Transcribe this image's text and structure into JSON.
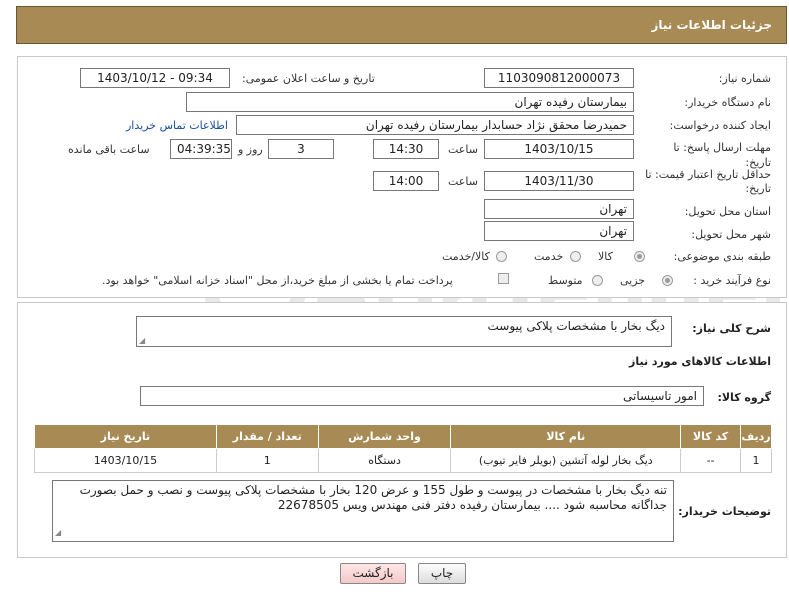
{
  "header": {
    "title": "جزئیات اطلاعات نیاز"
  },
  "form": {
    "need_number_label": "شماره نیاز:",
    "need_number": "1103090812000073",
    "announce_label": "تاریخ و ساعت اعلان عمومی:",
    "announce_value": "1403/10/12 - 09:34",
    "buyer_org_label": "نام دستگاه خریدار:",
    "buyer_org": "بیمارستان رفیده تهران",
    "creator_label": "ایجاد کننده درخواست:",
    "creator": "حمیدرضا  محقق نژاد حسابدار بیمارستان رفیده تهران",
    "contact_link": "اطلاعات تماس خریدار",
    "reply_deadline_label_1": "مهلت ارسال پاسخ: تا",
    "reply_deadline_label_2": "تاریخ:",
    "reply_date": "1403/10/15",
    "time_label": "ساعت",
    "reply_time": "14:30",
    "days_value": "3",
    "days_label": "روز و",
    "remaining_value": "04:39:35",
    "remaining_label": "ساعت باقی مانده",
    "price_validity_label_1": "حداقل تاریخ اعتبار قیمت: تا",
    "price_validity_label_2": "تاریخ:",
    "price_date": "1403/11/30",
    "price_time": "14:00",
    "province_label": "استان محل تحویل:",
    "province": "تهران",
    "city_label": "شهر محل تحویل:",
    "city": "تهران",
    "category_label": "طبقه بندی موضوعی:",
    "category_options": [
      "کالا",
      "خدمت",
      "کالا/خدمت"
    ],
    "category_selected": "کالا",
    "process_label": "نوع فرآیند خرید :",
    "process_options": [
      "جزیی",
      "متوسط"
    ],
    "process_selected": "جزیی",
    "payment_note": "پرداخت تمام یا بخشی از مبلغ خرید،از محل \"اسناد خزانه اسلامی\" خواهد بود."
  },
  "details": {
    "desc_label": "شرح کلی نیاز:",
    "desc_value": "دیگ بخار با مشخصات پلاکی پیوست",
    "goods_info_title": "اطلاعات کالاهای مورد نیاز",
    "group_label": "گروه کالا:",
    "group_value": "امور تاسیساتی"
  },
  "table": {
    "headers": [
      "ردیف",
      "کد کالا",
      "نام کالا",
      "واحد شمارش",
      "تعداد / مقدار",
      "تاریخ نیاز"
    ],
    "rows": [
      [
        "1",
        "--",
        "دیگ بخار لوله آتشین (بویلر فایر تیوب)",
        "دستگاه",
        "1",
        "1403/10/15"
      ]
    ]
  },
  "notes": {
    "label": "توضیحات خریدار:",
    "text": "تنه دیگ بخار با مشخصات در پیوست و طول 155 و عرض 120 بخار با مشخصات پلاکی پیوست و نصب و حمل بصورت جداگانه محاسبه شود .... بیمارستان رفیده دفتر فنی مهندس ویس 22678505"
  },
  "buttons": {
    "print": "چاپ",
    "back": "بازگشت"
  },
  "colors": {
    "header": "#a88a55",
    "link": "#1a4fa0",
    "back_button": "#f3c9c9"
  }
}
